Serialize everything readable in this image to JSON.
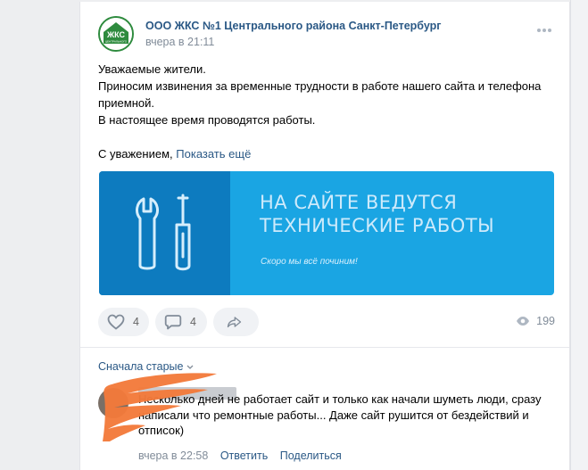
{
  "post": {
    "author": "ООО ЖКС №1 Центрального района Санкт-Петербург",
    "time": "вчера в 21:11",
    "avatar_text": "ЖКС",
    "avatar_subtext": "ЦЕНТРАЛЬНОГО",
    "text_lines": [
      "Уважаемые жители.",
      "Приносим извинения за временные трудности в работе нашего сайта и телефона приемной.",
      "В настоящее время проводятся работы.",
      "",
      "С уважением,"
    ],
    "show_more": "Показать ещё",
    "banner": {
      "title_line1": "НА САЙТЕ ВЕДУТСЯ",
      "title_line2": "ТЕХНИЧЕСКИЕ РАБОТЫ",
      "subtitle": "Скоро мы всё починим!"
    },
    "likes": "4",
    "comments": "4",
    "views": "199"
  },
  "comments_section": {
    "sort_label": "Сначала старые",
    "comment": {
      "text": "Несколько дней не работает сайт и только как начали шуметь люди, сразу написали что ремонтные работы... Даже сайт рушится от бездействий и отписок)",
      "time": "вчера в 22:58",
      "reply_label": "Ответить",
      "share_label": "Поделиться"
    }
  },
  "colors": {
    "link": "#2a5885",
    "banner_light": "#1aa5e3",
    "banner_dark": "#0d7bbf",
    "redaction": "#f27a3a"
  },
  "icons": [
    "more-dots-icon",
    "heart-icon",
    "comment-bubble-icon",
    "share-arrow-icon",
    "eye-icon",
    "chevron-down-icon",
    "wrench-icon",
    "screwdriver-icon"
  ]
}
